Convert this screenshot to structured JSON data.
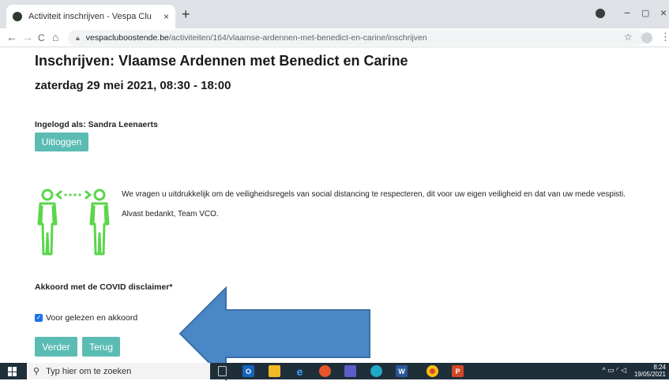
{
  "browser": {
    "tab_title": "Activiteit inschrijven - Vespa Clu",
    "tab_close": "×",
    "new_tab": "+",
    "url_domain": "vespacluboostende.be",
    "url_path": "/activiteiten/164/vlaamse-ardennen-met-benedict-en-carine/inschrijven",
    "back": "←",
    "forward": "→",
    "reload": "C",
    "home": "⌂",
    "minimize": "−",
    "maximize": "▢",
    "close": "×",
    "star": "☆",
    "menu": "⋮"
  },
  "page": {
    "title": "Inschrijven: Vlaamse Ardennen met Benedict en Carine",
    "date": "zaterdag 29 mei 2021, 08:30 - 18:00",
    "logged_in": "Ingelogd als: Sandra Leenaerts",
    "logout_label": "Uitloggen",
    "disclaimer_line1": "We vragen u uitdrukkelijk om de veiligheidsregels van social distancing te respecteren, dit voor uw eigen veiligheid en dat van uw mede vespisti.",
    "disclaimer_line2": "Alvast bedankt, Team VCO.",
    "agree_label": "Akkoord met de COVID disclaimer*",
    "checkbox_label": "Voor gelezen en akkoord",
    "checkbox_checked": true,
    "next_label": "Verder",
    "back_label": "Terug"
  },
  "colors": {
    "button": "#5bbcb4",
    "illustration": "#5ad64a",
    "arrow": "#4a87c6",
    "taskbar": "#1f2f3a"
  },
  "taskbar": {
    "search_placeholder": "Typ hier om te zoeken",
    "time": "8:24",
    "date": "19/05/2021",
    "apps": [
      "task-view-icon",
      "outlook-icon",
      "file-explorer-icon",
      "edge-legacy-icon",
      "firefox-icon",
      "teams-icon",
      "edge-icon",
      "word-icon",
      "chrome-icon",
      "powerpoint-icon"
    ]
  }
}
